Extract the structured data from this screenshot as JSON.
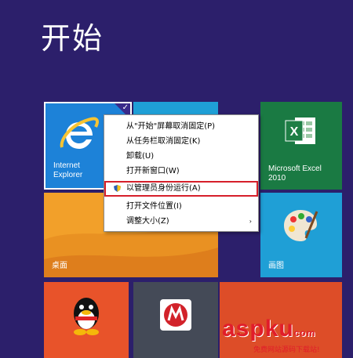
{
  "page": {
    "title": "开始"
  },
  "tiles": {
    "ie": {
      "label": "Internet\nExplorer"
    },
    "excel": {
      "label": "Microsoft Excel\n2010"
    },
    "desktop": {
      "label": "桌面"
    },
    "paint": {
      "label": "画图"
    }
  },
  "context_menu": {
    "items": [
      {
        "label": "从\"开始\"屏幕取消固定(P)"
      },
      {
        "label": "从任务栏取消固定(K)"
      },
      {
        "label": "卸载(U)"
      },
      {
        "label": "打开新窗口(W)"
      },
      {
        "label": "以管理员身份运行(A)",
        "highlighted": true,
        "icon": "shield-icon"
      },
      {
        "label": "打开文件位置(I)"
      },
      {
        "label": "调整大小(Z)",
        "has_submenu": true
      }
    ],
    "highlight_color": "#d61f2a"
  },
  "watermark": {
    "brand": "aspku",
    "brand_suffix": "com",
    "tagline": "免费网站源码下载站!"
  },
  "colors": {
    "background": "#2c1f6b",
    "ie_tile": "#1d82d8",
    "excel_tile": "#1a7a43",
    "desktop_tile": "#f2a02a",
    "qq_tile": "#e8532a"
  }
}
